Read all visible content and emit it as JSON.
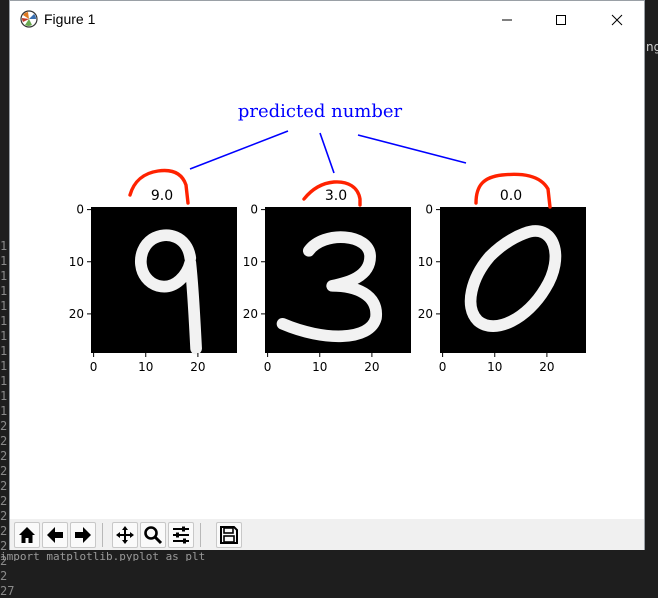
{
  "window": {
    "title": "Figure 1"
  },
  "annotation": {
    "text": "predicted number",
    "color": "#0000ff",
    "marker_color": "#ff2200"
  },
  "subplots": [
    {
      "title": "9.0",
      "digit": "9",
      "xticks": [
        "0",
        "10",
        "20"
      ],
      "yticks": [
        "0",
        "10",
        "20"
      ]
    },
    {
      "title": "3.0",
      "digit": "3",
      "xticks": [
        "0",
        "10",
        "20"
      ],
      "yticks": [
        "0",
        "10",
        "20"
      ]
    },
    {
      "title": "0.0",
      "digit": "0",
      "xticks": [
        "0",
        "10",
        "20"
      ],
      "yticks": [
        "0",
        "10",
        "20"
      ]
    }
  ],
  "toolbar": {
    "buttons": [
      "home-icon",
      "back-arrow-icon",
      "forward-arrow-icon",
      "pan-icon",
      "zoom-icon",
      "configure-subplots-icon",
      "save-icon"
    ]
  },
  "background": {
    "line_numbers": [
      "1",
      "1",
      "1",
      "1",
      "1",
      "1",
      "1",
      "1",
      "1",
      "1",
      "1",
      "1",
      "2",
      "2",
      "2",
      "2",
      "2",
      "2",
      "2",
      "2",
      "2",
      "2",
      "2",
      "27"
    ],
    "right_fragment": "ng",
    "bottom_code": "    import matplotlib.pyplot as plt"
  }
}
